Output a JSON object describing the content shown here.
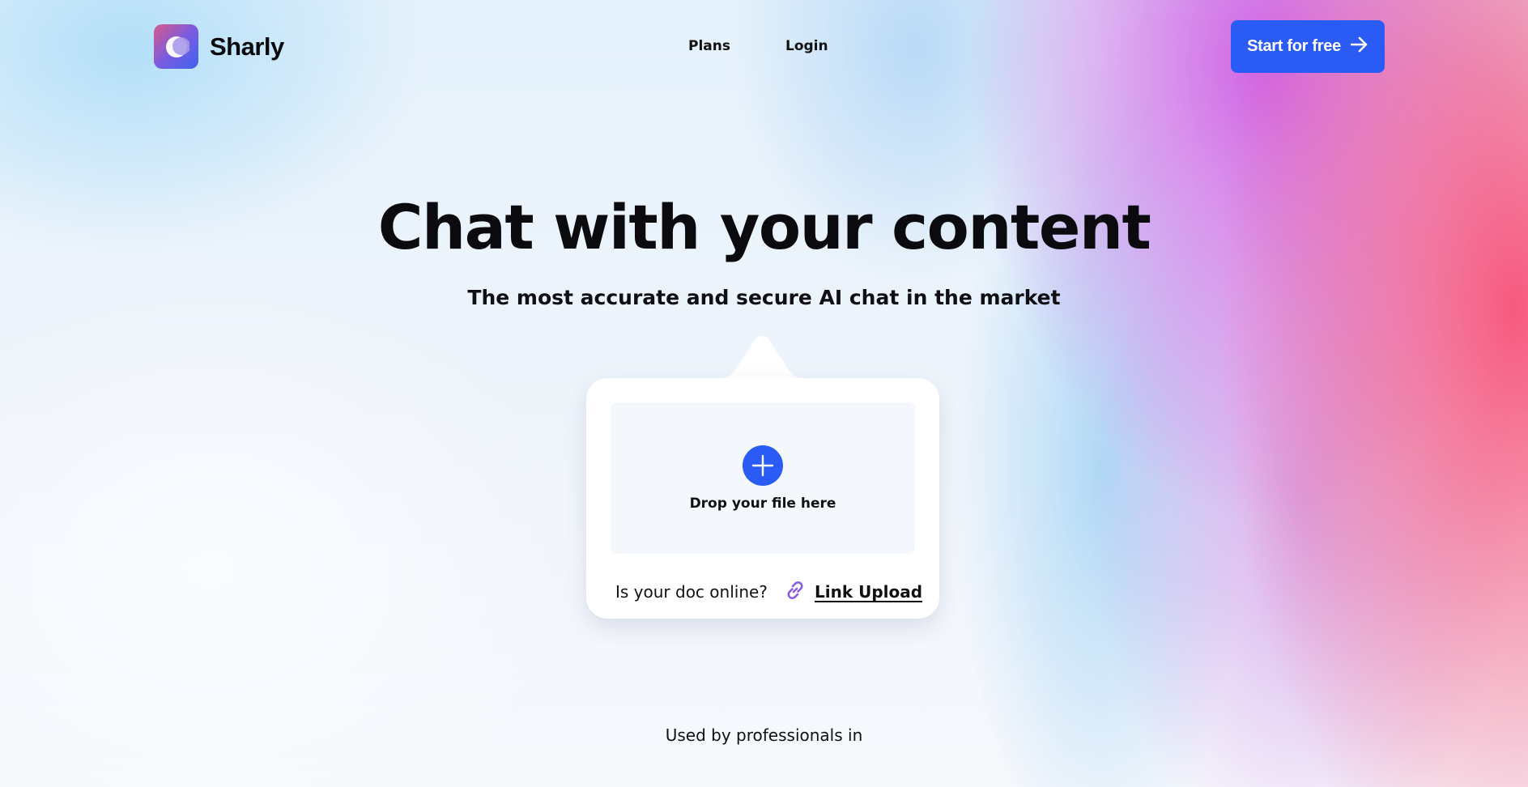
{
  "brand": {
    "name": "Sharly",
    "logo_icon": "crescent-moon-logo-icon",
    "accent_color": "#2a5cf5"
  },
  "nav": {
    "items": [
      {
        "label": "Plans"
      },
      {
        "label": "Login"
      }
    ]
  },
  "cta": {
    "label": "Start for free",
    "icon": "arrow-right-icon"
  },
  "hero": {
    "title": "Chat with your content",
    "subtitle": "The most accurate and secure AI chat in the market"
  },
  "upload": {
    "drop_label": "Drop your file here",
    "drop_icon": "plus-icon",
    "online_question": "Is your doc online?",
    "link_icon": "link-icon",
    "link_label": "Link Upload"
  },
  "footer": {
    "used_by": "Used by professionals in"
  }
}
